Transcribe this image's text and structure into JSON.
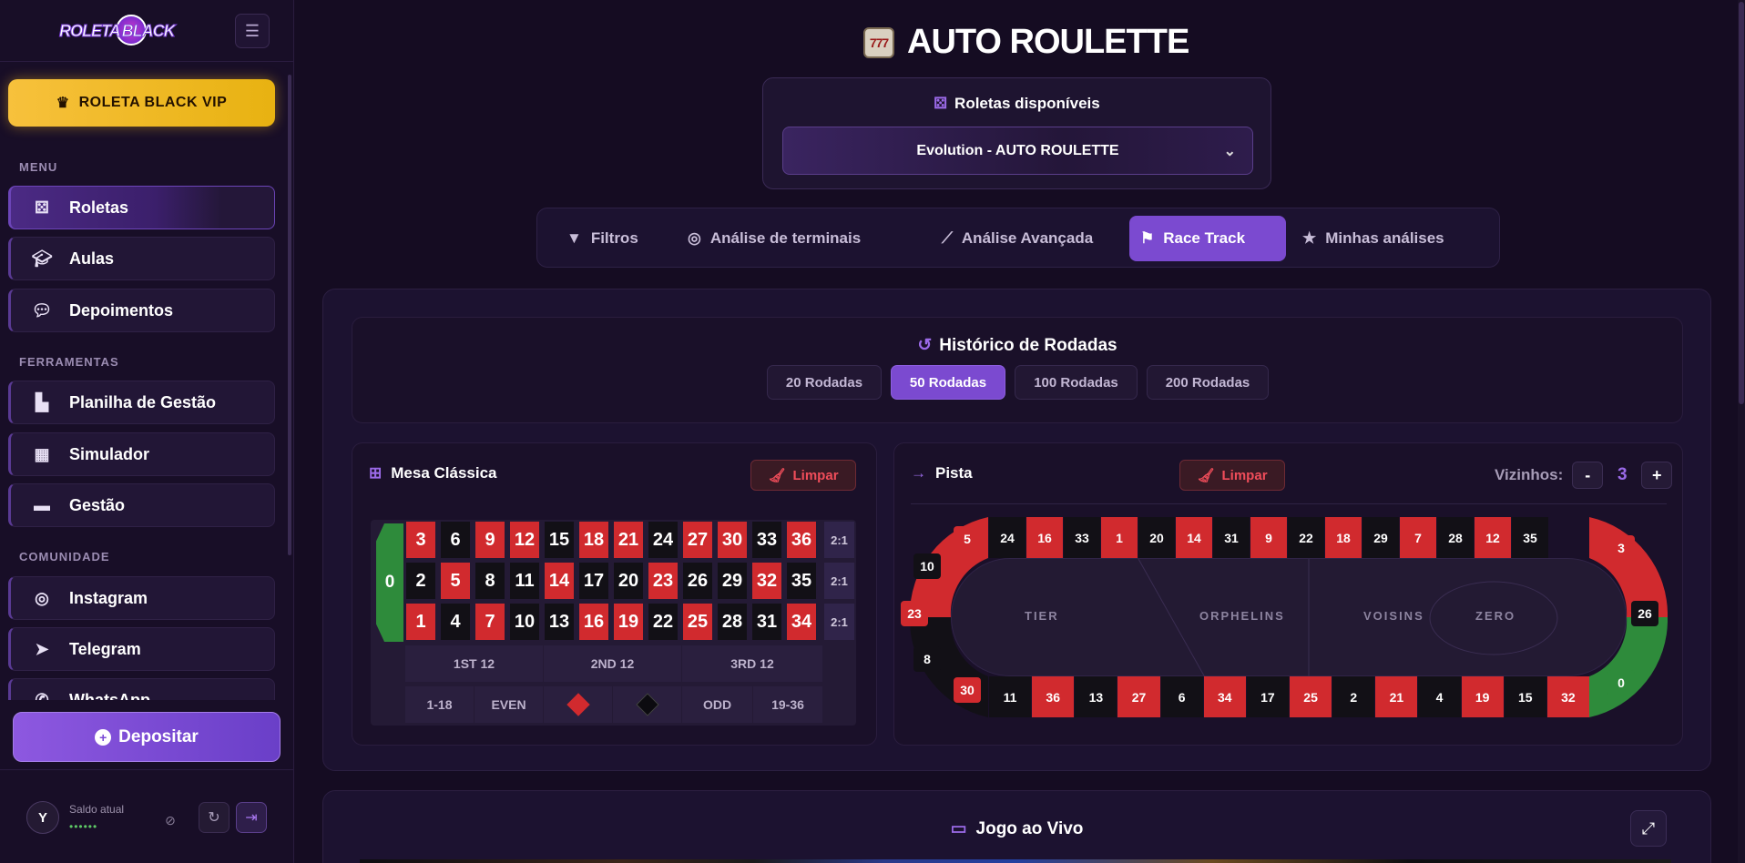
{
  "logo": {
    "text_left": "ROLETA",
    "text_right": "BLACK"
  },
  "vip": {
    "label": "ROLETA BLACK VIP"
  },
  "sidebar": {
    "sections": {
      "menu": "MENU",
      "ferramentas": "FERRAMENTAS",
      "comunidade": "COMUNIDADE"
    },
    "items": [
      {
        "label": "Roletas",
        "icon": "dice-icon"
      },
      {
        "label": "Aulas",
        "icon": "graduation-cap-icon"
      },
      {
        "label": "Depoimentos",
        "icon": "comments-icon"
      },
      {
        "label": "Planilha de Gestão",
        "icon": "chart-icon"
      },
      {
        "label": "Simulador",
        "icon": "calculator-icon"
      },
      {
        "label": "Gestão",
        "icon": "wallet-icon"
      },
      {
        "label": "Instagram",
        "icon": "instagram-icon"
      },
      {
        "label": "Telegram",
        "icon": "telegram-icon"
      },
      {
        "label": "WhatsApp",
        "icon": "whatsapp-icon"
      }
    ],
    "deposit": "Depositar",
    "balance": {
      "avatar": "Y",
      "label": "Saldo atual",
      "value": "••••••"
    }
  },
  "page": {
    "title": "AUTO ROULETTE"
  },
  "selector": {
    "label": "Roletas disponíveis",
    "value": "Evolution - AUTO ROULETTE"
  },
  "tabs": [
    {
      "label": "Filtros"
    },
    {
      "label": "Análise de terminais"
    },
    {
      "label": "Análise Avançada"
    },
    {
      "label": "Race Track"
    },
    {
      "label": "Minhas análises"
    }
  ],
  "history": {
    "title": "Histórico de Rodadas",
    "options": [
      "20 Rodadas",
      "50 Rodadas",
      "100 Rodadas",
      "200 Rodadas"
    ],
    "selected": "50 Rodadas"
  },
  "mesa": {
    "title": "Mesa Clássica",
    "clear": "Limpar",
    "zero": "0",
    "rows": [
      [
        [
          "3",
          "r"
        ],
        [
          "6",
          "b"
        ],
        [
          "9",
          "r"
        ],
        [
          "12",
          "r"
        ],
        [
          "15",
          "b"
        ],
        [
          "18",
          "r"
        ],
        [
          "21",
          "r"
        ],
        [
          "24",
          "b"
        ],
        [
          "27",
          "r"
        ],
        [
          "30",
          "r"
        ],
        [
          "33",
          "b"
        ],
        [
          "36",
          "r"
        ]
      ],
      [
        [
          "2",
          "b"
        ],
        [
          "5",
          "r"
        ],
        [
          "8",
          "b"
        ],
        [
          "11",
          "b"
        ],
        [
          "14",
          "r"
        ],
        [
          "17",
          "b"
        ],
        [
          "20",
          "b"
        ],
        [
          "23",
          "r"
        ],
        [
          "26",
          "b"
        ],
        [
          "29",
          "b"
        ],
        [
          "32",
          "r"
        ],
        [
          "35",
          "b"
        ]
      ],
      [
        [
          "1",
          "r"
        ],
        [
          "4",
          "b"
        ],
        [
          "7",
          "r"
        ],
        [
          "10",
          "b"
        ],
        [
          "13",
          "b"
        ],
        [
          "16",
          "r"
        ],
        [
          "19",
          "r"
        ],
        [
          "22",
          "b"
        ],
        [
          "25",
          "r"
        ],
        [
          "28",
          "b"
        ],
        [
          "31",
          "b"
        ],
        [
          "34",
          "r"
        ]
      ]
    ],
    "columns": [
      "2:1",
      "2:1",
      "2:1"
    ],
    "dozens": [
      "1ST 12",
      "2ND 12",
      "3RD 12"
    ],
    "outside": [
      "1-18",
      "EVEN",
      "ODD",
      "19-36"
    ]
  },
  "pista": {
    "title": "Pista",
    "clear": "Limpar",
    "neighbors_label": "Vizinhos:",
    "neighbors_minus": "-",
    "neighbors_value": "3",
    "neighbors_plus": "+",
    "top": [
      [
        "24",
        "b"
      ],
      [
        "16",
        "r"
      ],
      [
        "33",
        "b"
      ],
      [
        "1",
        "r"
      ],
      [
        "20",
        "b"
      ],
      [
        "14",
        "r"
      ],
      [
        "31",
        "b"
      ],
      [
        "9",
        "r"
      ],
      [
        "22",
        "b"
      ],
      [
        "18",
        "r"
      ],
      [
        "29",
        "b"
      ],
      [
        "7",
        "r"
      ],
      [
        "28",
        "b"
      ],
      [
        "12",
        "r"
      ],
      [
        "35",
        "b"
      ]
    ],
    "bottom": [
      [
        "11",
        "b"
      ],
      [
        "36",
        "r"
      ],
      [
        "13",
        "b"
      ],
      [
        "27",
        "r"
      ],
      [
        "6",
        "b"
      ],
      [
        "34",
        "r"
      ],
      [
        "17",
        "b"
      ],
      [
        "25",
        "r"
      ],
      [
        "2",
        "b"
      ],
      [
        "21",
        "r"
      ],
      [
        "4",
        "b"
      ],
      [
        "19",
        "r"
      ],
      [
        "15",
        "b"
      ],
      [
        "32",
        "r"
      ]
    ],
    "left": [
      [
        "5",
        "r"
      ],
      [
        "10",
        "b"
      ],
      [
        "23",
        "r"
      ],
      [
        "8",
        "b"
      ],
      [
        "30",
        "r"
      ]
    ],
    "right": [
      [
        "3",
        "r"
      ],
      [
        "26",
        "b"
      ],
      [
        "0",
        "g"
      ]
    ],
    "zones": [
      "TIER",
      "ORPHELINS",
      "VOISINS",
      "ZERO"
    ]
  },
  "live": {
    "title": "Jogo ao Vivo"
  }
}
